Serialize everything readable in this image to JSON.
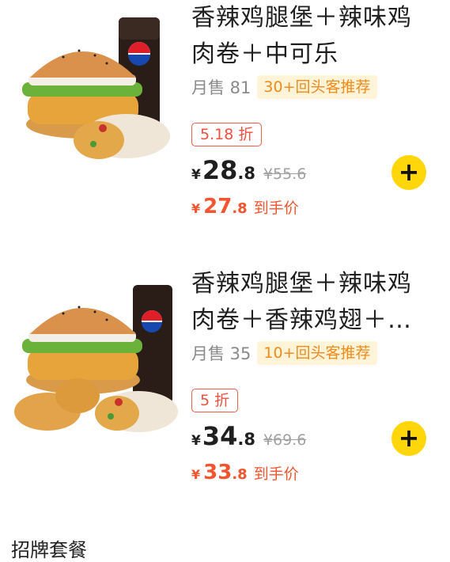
{
  "products": [
    {
      "title": "香辣鸡腿堡＋辣味鸡肉卷＋中可乐",
      "sales": "月售 81",
      "tag": "30+回头客推荐",
      "discount": "5.18 折",
      "currency": "¥",
      "price_int": "28",
      "price_dec": ".8",
      "original_price": "¥55.6",
      "final_int": "27",
      "final_dec": ".8",
      "final_label": "到手价",
      "add": "+"
    },
    {
      "title": "香辣鸡腿堡＋辣味鸡肉卷＋香辣鸡翅＋…",
      "sales": "月售 35",
      "tag": "10+回头客推荐",
      "discount": "5 折",
      "currency": "¥",
      "price_int": "34",
      "price_dec": ".8",
      "original_price": "¥69.6",
      "final_int": "33",
      "final_dec": ".8",
      "final_label": "到手价",
      "add": "+"
    }
  ],
  "section_peek": "招牌套餐",
  "colors": {
    "accent": "#f2552f",
    "add_button": "#ffd60a",
    "tag_bg": "#fff3d8",
    "tag_text": "#f08a18"
  }
}
